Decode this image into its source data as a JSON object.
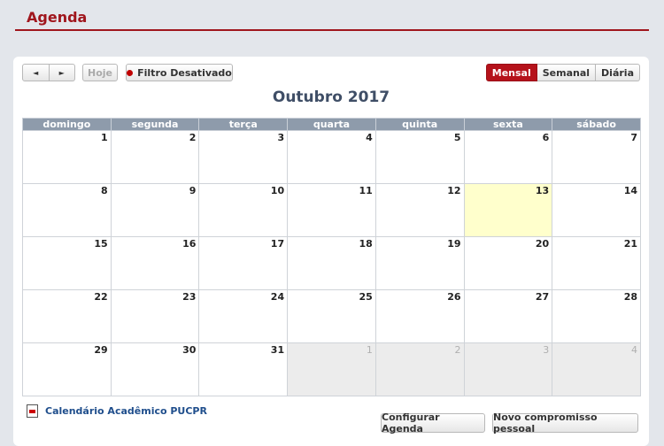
{
  "header": {
    "title": "Agenda"
  },
  "toolbar": {
    "prev_symbol": "◄",
    "next_symbol": "►",
    "today_label": "Hoje",
    "filter_label": "Filtro Desativado",
    "views": [
      "Mensal",
      "Semanal",
      "Diária"
    ],
    "active_view": "Mensal"
  },
  "calendar": {
    "month_title": "Outubro 2017",
    "weekdays": [
      "domingo",
      "segunda",
      "terça",
      "quarta",
      "quinta",
      "sexta",
      "sábado"
    ],
    "weeks": [
      [
        "1",
        "2",
        "3",
        "4",
        "5",
        "6",
        "7"
      ],
      [
        "8",
        "9",
        "10",
        "11",
        "12",
        "13",
        "14"
      ],
      [
        "15",
        "16",
        "17",
        "18",
        "19",
        "20",
        "21"
      ],
      [
        "22",
        "23",
        "24",
        "25",
        "26",
        "27",
        "28"
      ],
      [
        "29",
        "30",
        "31",
        "1",
        "2",
        "3",
        "4"
      ]
    ],
    "today": "13"
  },
  "links": [
    {
      "label": "Calendário Acadêmico PUCPR"
    }
  ],
  "actions": {
    "configure_label": "Configurar Agenda",
    "new_label": "Novo compromisso pessoal"
  },
  "colors": {
    "accent": "#b5121b",
    "header_bg": "#8e9bab",
    "today_bg": "#ffffcc"
  }
}
